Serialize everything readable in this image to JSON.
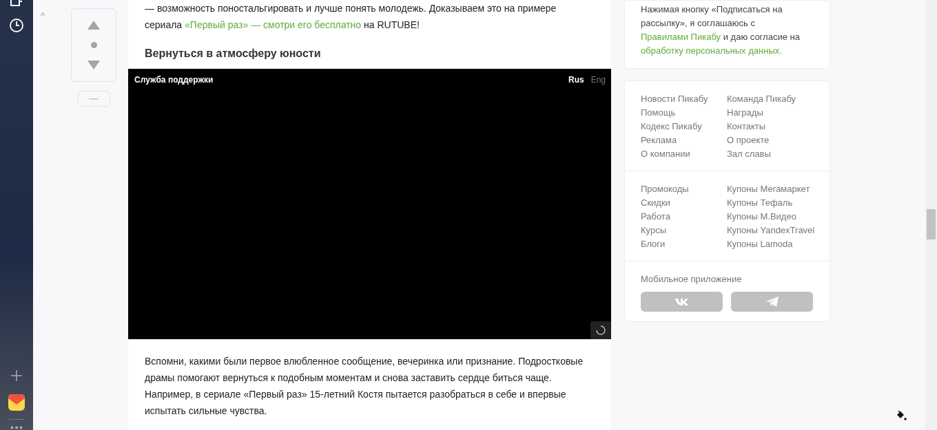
{
  "vote_panel": {
    "collapse_icon": "^"
  },
  "article": {
    "intro": [
      {
        "kind": "text",
        "text": "— возможность поностальгировать и лучше понять молодежь. Доказываем это на примере сериала "
      },
      {
        "kind": "link",
        "text": "«Первый раз» — смотри его бесплатно"
      },
      {
        "kind": "text",
        "text": " на RUTUBE!"
      }
    ],
    "heading": "Вернуться в атмосферу юности",
    "video": {
      "title": "Служба поддержки",
      "languages": [
        {
          "label": "Rus",
          "selected": true
        },
        {
          "label": "Eng",
          "selected": false
        }
      ]
    },
    "body": "Вспомни, какими были первое влюбленное сообщение, вечеринка или признание. Подростковые драмы помогают вернуться к подобным моментам и снова заставить сердце биться чаще. Например, в сериале «Первый раз» 15-летний Костя пытается разобраться в себе и впервые испытать сильные чувства."
  },
  "consent": [
    {
      "kind": "text",
      "text": "Нажимая кнопку «Подписаться на рассылку», я соглашаюсь с "
    },
    {
      "kind": "link",
      "text": "Правилами Пикабу"
    },
    {
      "kind": "text",
      "text": " и даю согласие на "
    },
    {
      "kind": "link",
      "text": "обработку персональных данных."
    }
  ],
  "footer_links": [
    [
      "Новости Пикабу",
      "Команда Пикабу",
      "Помощь",
      "Награды",
      "Кодекс Пикабу",
      "Контакты",
      "Реклама",
      "О проекте",
      "О компании",
      "Зал славы"
    ],
    [
      "Промокоды",
      "Купоны Мегамаркет",
      "Скидки",
      "Купоны Тефаль",
      "Работа",
      "Купоны М.Видео",
      "Курсы",
      "Купоны YandexTravel",
      "Блоги",
      "Купоны Lamoda"
    ]
  ],
  "mobile_app": {
    "label": "Мобильное приложение"
  }
}
